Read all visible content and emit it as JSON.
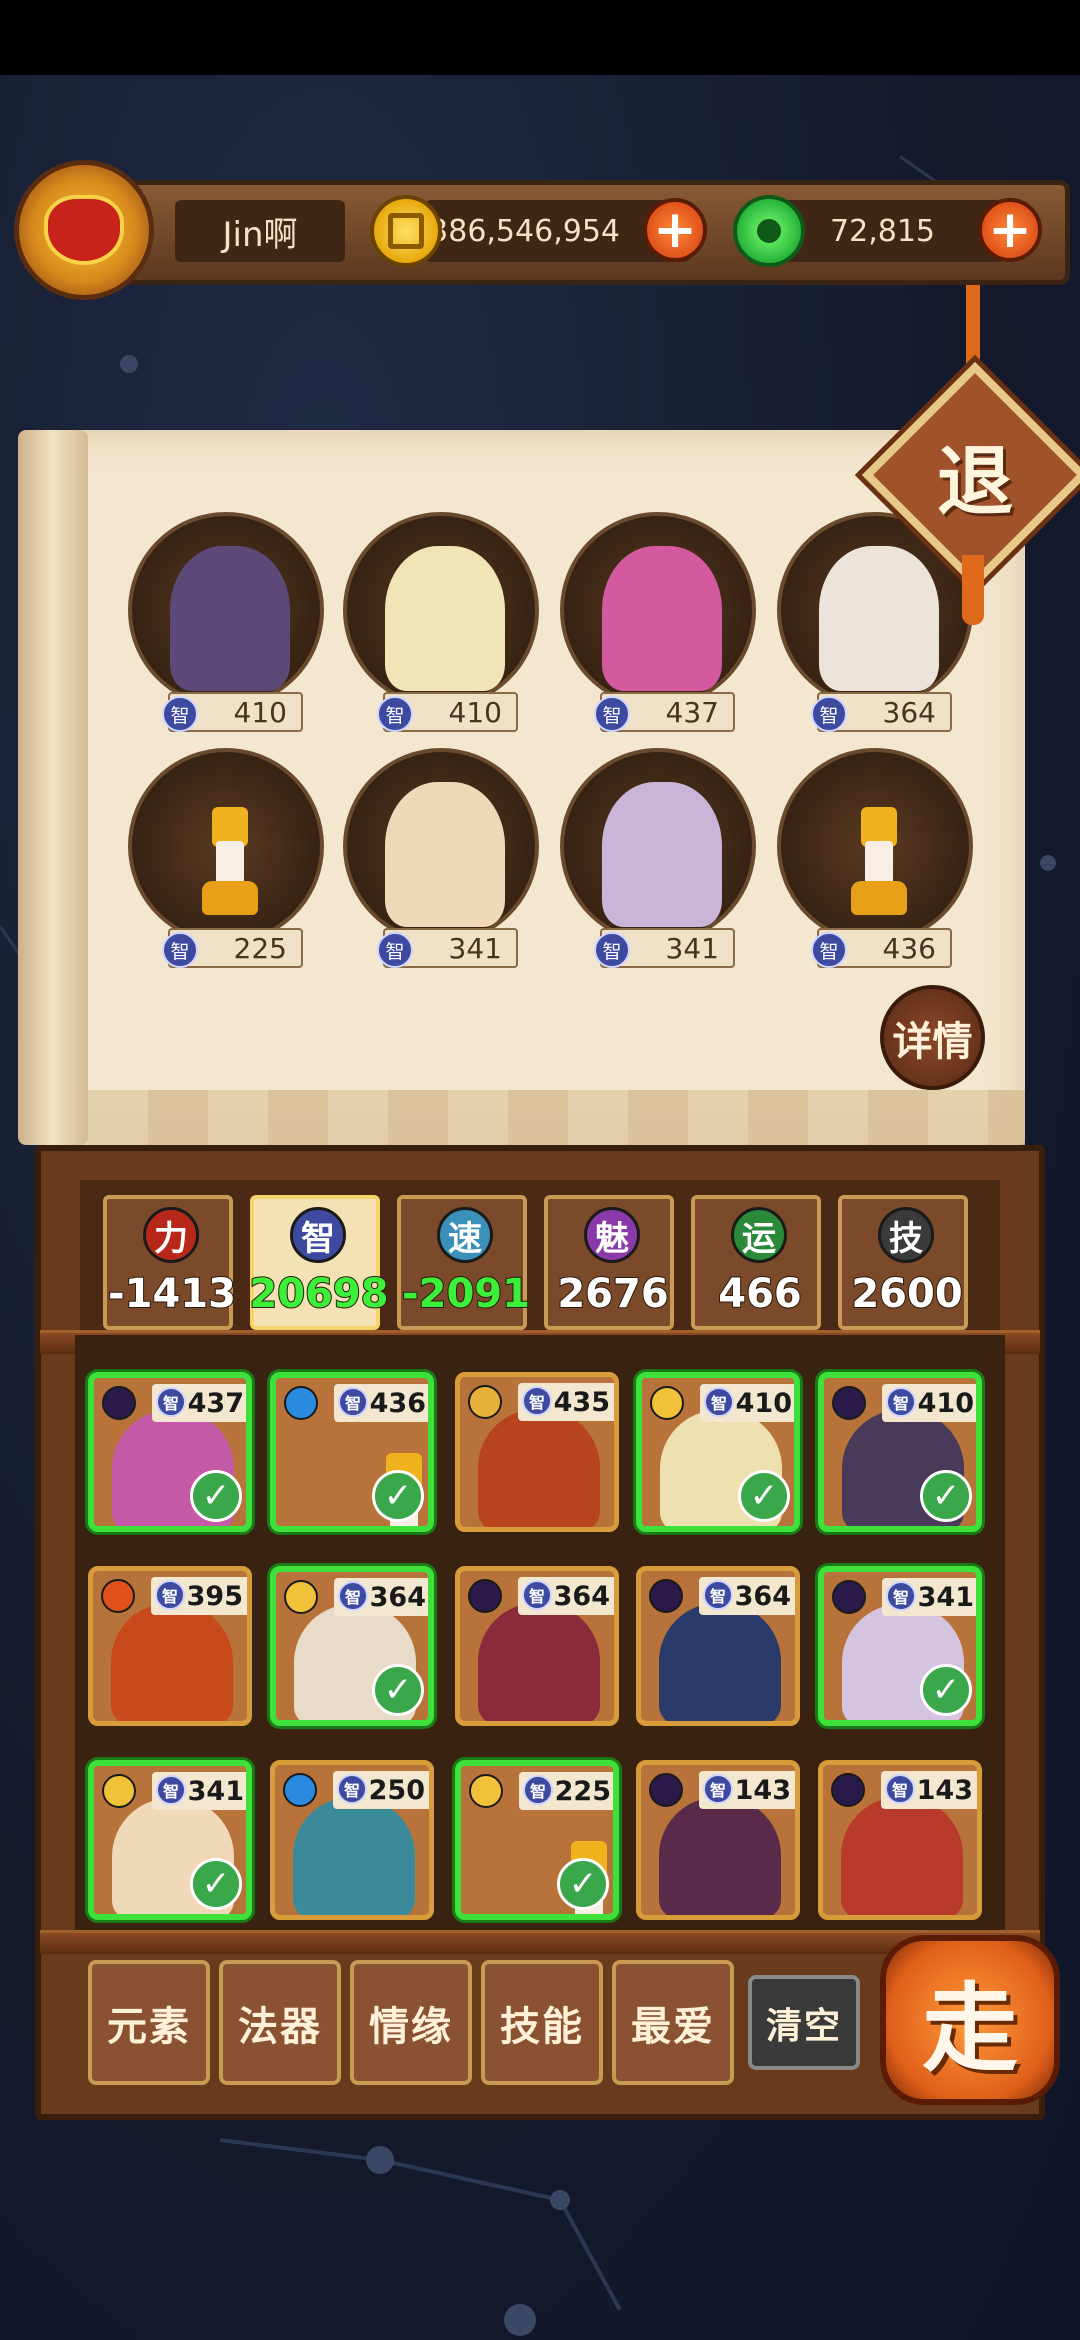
{
  "player": {
    "name": "Jin啊"
  },
  "currency": {
    "coins": "1,386,546,954",
    "jade": "72,815",
    "add_label": "+"
  },
  "buttons": {
    "retreat": "退",
    "details": "详情",
    "go": "走"
  },
  "stat_icon_label": "智",
  "lineup": [
    {
      "value": "410",
      "color": "#5b4a78"
    },
    {
      "value": "410",
      "color": "#f1e4b6"
    },
    {
      "value": "437",
      "color": "#d45aa0"
    },
    {
      "value": "364",
      "color": "#ece4da"
    },
    {
      "value": "225",
      "color": "chess"
    },
    {
      "value": "341",
      "color": "#f0d9b8"
    },
    {
      "value": "341",
      "color": "#c9b5d8"
    },
    {
      "value": "436",
      "color": "chess"
    }
  ],
  "attributes": [
    {
      "label": "力",
      "value": "-1413",
      "icon_color": "#b8281a",
      "active": false,
      "green": false
    },
    {
      "label": "智",
      "value": "20698",
      "icon_color": "#3d4aa0",
      "active": true,
      "green": true
    },
    {
      "label": "速",
      "value": "-2091",
      "icon_color": "#3a90b8",
      "active": false,
      "green": true
    },
    {
      "label": "魅",
      "value": "2676",
      "icon_color": "#8a3aa8",
      "active": false,
      "green": false
    },
    {
      "label": "运",
      "value": "466",
      "icon_color": "#2a8a3a",
      "active": false,
      "green": false
    },
    {
      "label": "技",
      "value": "2600",
      "icon_color": "#3a3a3a",
      "active": false,
      "green": false
    }
  ],
  "roster": [
    {
      "value": "437",
      "selected": true,
      "element": "#2a1a4a",
      "color": "#c45aa8"
    },
    {
      "value": "436",
      "selected": true,
      "element": "#2a8ae0",
      "color": "chess"
    },
    {
      "value": "435",
      "selected": false,
      "element": "#e8b23a",
      "color": "#b8441e"
    },
    {
      "value": "410",
      "selected": true,
      "element": "#f0c23a",
      "color": "#efe0b0"
    },
    {
      "value": "410",
      "selected": true,
      "element": "#2a1a4a",
      "color": "#4a3a5a"
    },
    {
      "value": "395",
      "selected": false,
      "element": "#e0501a",
      "color": "#c84a1c"
    },
    {
      "value": "364",
      "selected": true,
      "element": "#f0c23a",
      "color": "#e8dcc8"
    },
    {
      "value": "364",
      "selected": false,
      "element": "#2a1a4a",
      "color": "#8a2a3a"
    },
    {
      "value": "364",
      "selected": false,
      "element": "#2a1a4a",
      "color": "#2a3a6a"
    },
    {
      "value": "341",
      "selected": true,
      "element": "#2a1a4a",
      "color": "#d4c4e0"
    },
    {
      "value": "341",
      "selected": true,
      "element": "#f0c23a",
      "color": "#f0d9b8"
    },
    {
      "value": "250",
      "selected": false,
      "element": "#2a8ae0",
      "color": "#3a8a9a"
    },
    {
      "value": "225",
      "selected": true,
      "element": "#f0c23a",
      "color": "chess"
    },
    {
      "value": "143",
      "selected": false,
      "element": "#2a1a4a",
      "color": "#5a2a4a"
    },
    {
      "value": "143",
      "selected": false,
      "element": "#2a1a4a",
      "color": "#b83a2a"
    }
  ],
  "filters": [
    {
      "label": "元素"
    },
    {
      "label": "法器"
    },
    {
      "label": "情缘"
    },
    {
      "label": "技能"
    },
    {
      "label": "最爱"
    }
  ],
  "clear_label": "清空"
}
